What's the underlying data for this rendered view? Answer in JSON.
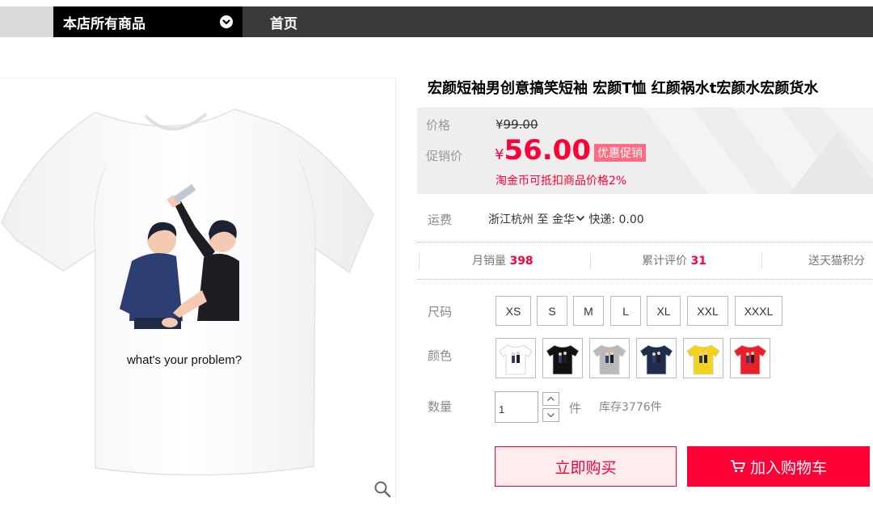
{
  "nav": {
    "all_products": "本店所有商品",
    "home": "首页"
  },
  "product": {
    "title": "宏颜短袖男创意搞笑短袖 宏颜T恤 红颜祸水t宏颜水宏颜货水",
    "image_caption": "what's your problem?"
  },
  "price": {
    "label": "价格",
    "currency": "¥",
    "original": "99.00",
    "promo_label": "促销价",
    "promo": "56.00",
    "promo_tag": "优惠促销",
    "coin_note": "淘金币可抵扣商品价格2%"
  },
  "shipping": {
    "label": "运费",
    "from": "浙江杭州",
    "to_label": "至",
    "to": "金华",
    "method": "快递: 0.00"
  },
  "stats": {
    "monthly_sales_label": "月销量",
    "monthly_sales": "398",
    "reviews_label": "累计评价",
    "reviews": "31",
    "points_label": "送天猫积分"
  },
  "sizes": {
    "label": "尺码",
    "options": [
      "XS",
      "S",
      "M",
      "L",
      "XL",
      "XXL",
      "XXXL"
    ]
  },
  "colors": {
    "label": "颜色",
    "swatches": [
      "white",
      "black",
      "grey",
      "navy",
      "yellow",
      "red"
    ],
    "swatch_hex": [
      "#ffffff",
      "#111111",
      "#b9b9b9",
      "#1f2d4d",
      "#f3d31b",
      "#e8202a"
    ]
  },
  "quantity": {
    "label": "数量",
    "value": "1",
    "unit": "件",
    "stock": "库存3776件"
  },
  "actions": {
    "buy_now": "立即购买",
    "add_to_cart": "加入购物车"
  },
  "icons": {
    "nav_chevron": "chevron-down-icon",
    "zoom": "magnifier-icon",
    "cart": "cart-icon",
    "qty_up": "caret-up-icon",
    "qty_down": "caret-down-icon"
  },
  "colors_theme": {
    "accent": "#ff0036",
    "nav_black": "#000000",
    "nav_dark": "#3a3a3a",
    "price_bg": "#eeeeee"
  }
}
